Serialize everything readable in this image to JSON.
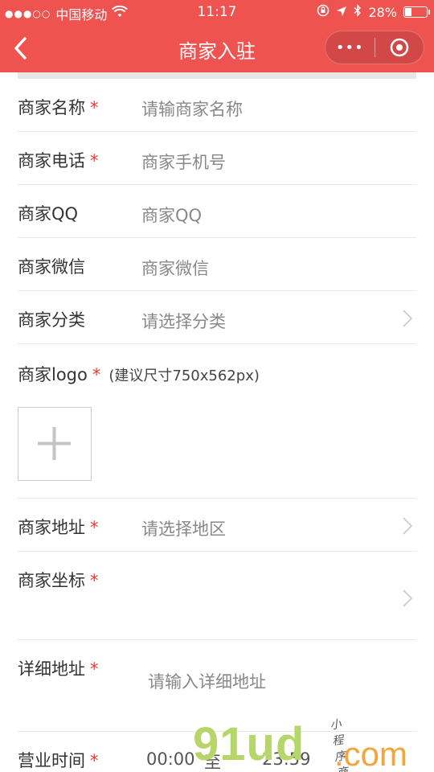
{
  "status_bar": {
    "signal": "●●●○○",
    "carrier": "中国移动",
    "time": "11:17",
    "battery": "28%",
    "battery_level": 0.28
  },
  "nav": {
    "title": "商家入驻",
    "more_label": "•••"
  },
  "form": {
    "required_mark": "*",
    "name": {
      "label": "商家名称",
      "placeholder": "请输商家名称"
    },
    "phone": {
      "label": "商家电话",
      "placeholder": "商家手机号"
    },
    "qq": {
      "label": "商家QQ",
      "placeholder": "商家QQ"
    },
    "wechat": {
      "label": "商家微信",
      "placeholder": "商家微信"
    },
    "category": {
      "label": "商家分类",
      "placeholder": "请选择分类"
    },
    "logo": {
      "label": "商家logo",
      "hint": "(建议尺寸750x562px)"
    },
    "address": {
      "label": "商家地址",
      "placeholder": "请选择地区"
    },
    "coordinates": {
      "label": "商家坐标"
    },
    "detail_address": {
      "label": "详细地址",
      "placeholder": "请输入详细地址"
    },
    "hours": {
      "label": "营业时间",
      "start": "00:00",
      "separator": "至",
      "end": "23:59"
    }
  },
  "watermark": {
    "main": "91ud",
    "suffix": ".com",
    "tagline": "小程序商店"
  },
  "colors": {
    "header": "#ef5350",
    "required": "#e53935"
  }
}
